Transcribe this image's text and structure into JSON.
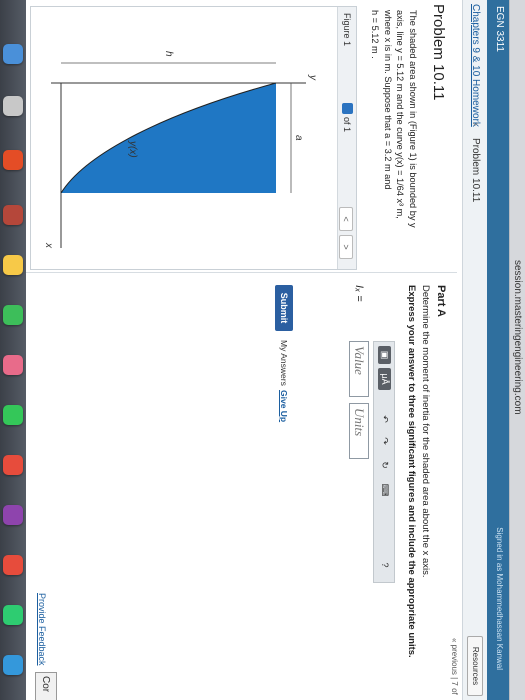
{
  "browser": {
    "url": "session.masteringengineering.com"
  },
  "topbar": {
    "course_code": "EGN 3311",
    "signed_in": "Signed in as Mohammedhassan Kanwal"
  },
  "breadcrumb": {
    "home": "Chapters 9 & 10 Homework",
    "separator": "›",
    "current": "Problem 10.11"
  },
  "resources_label": "Resources",
  "pager": "« previous | 7 of",
  "problem": {
    "title": "Problem 10.11",
    "statement_lines": [
      "The shaded area shown in (Figure 1) is bounded by y",
      "axis, line y = 5.12  m and the curve y(x) = 1/64 x³ m,",
      "where x is in m. Suppose that a = 3.2  m and",
      "h = 5.12  m ."
    ]
  },
  "figure": {
    "label": "Figure 1",
    "index": "1",
    "of_text": "of 1",
    "prev": "<",
    "next": ">",
    "labels": {
      "y_axis": "y",
      "x_axis": "x",
      "h": "h",
      "a": "a",
      "curve": "y(x)"
    },
    "shade_color": "#1f77c4"
  },
  "part": {
    "title": "Part A",
    "question": "Determine the moment of inertia for the shaded area about the x axis.",
    "instruction": "Express your answer to three significant figures and include the appropriate units.",
    "answer_label": "Iₓ =",
    "value_placeholder": "Value",
    "units_placeholder": "Units",
    "toolbar": {
      "templates": "▣",
      "units": "μÅ",
      "undo": "↶",
      "redo": "↷",
      "reset": "↻",
      "keyboard": "⌨",
      "help": "?"
    },
    "submit": "Submit",
    "my_answers": "My Answers",
    "give_up": "Give Up"
  },
  "feedback": "Provide Feedback",
  "next_button": "Cor",
  "colors": {
    "accent": "#2f6f9e",
    "submit": "#2b5fa1",
    "link": "#1c5fa0"
  }
}
